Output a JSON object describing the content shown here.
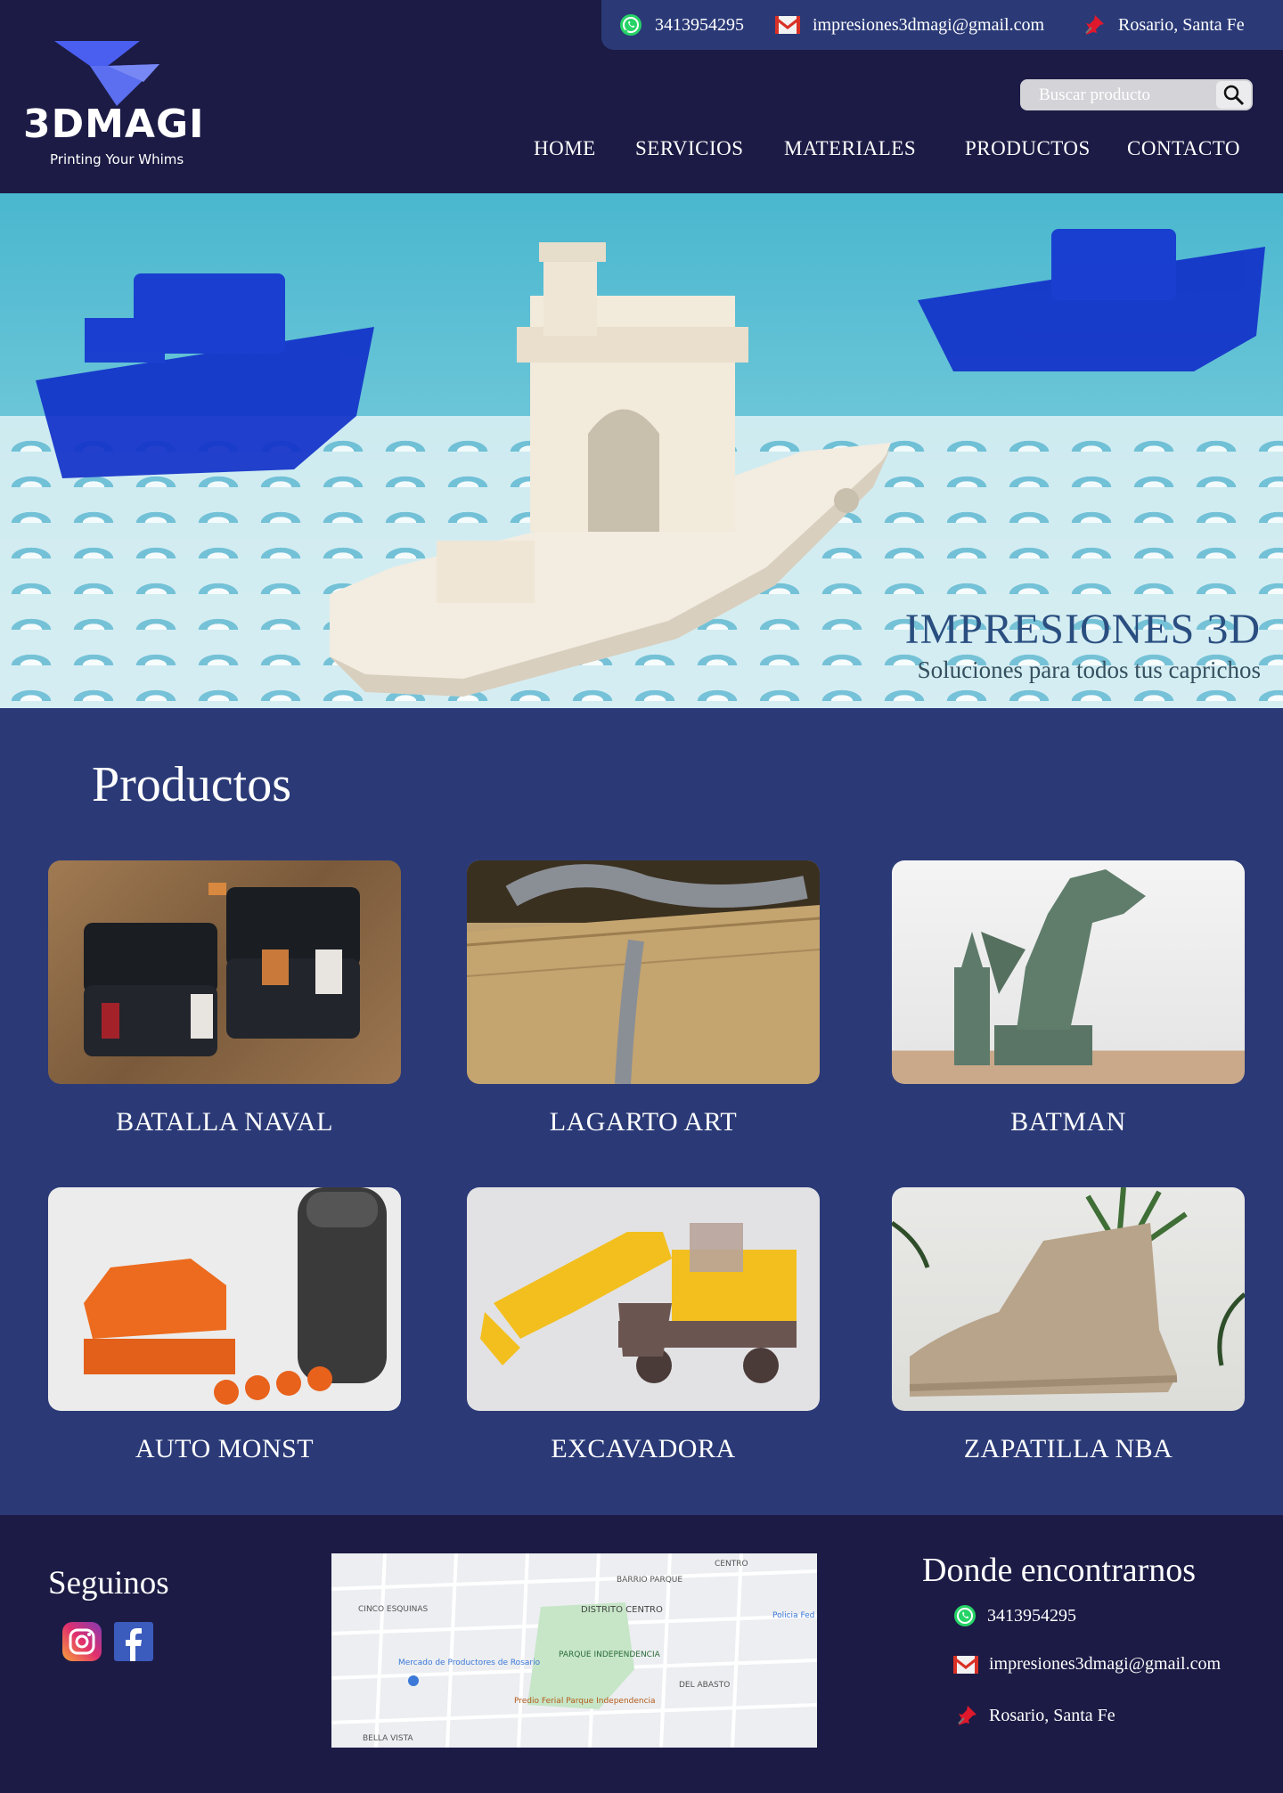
{
  "contact": {
    "phone": "3413954295",
    "email": "impresiones3dmagi@gmail.com",
    "location": "Rosario, Santa Fe"
  },
  "brand": {
    "name": "3DMAGI",
    "tagline": "Printing Your Whims"
  },
  "search": {
    "placeholder": "Buscar producto"
  },
  "nav": {
    "items": [
      "HOME",
      "SERVICIOS",
      "MATERIALES",
      "PRODUCTOS",
      "CONTACTO"
    ]
  },
  "hero": {
    "title": "IMPRESIONES 3D",
    "subtitle": "Soluciones para todos tus caprichos"
  },
  "products": {
    "heading": "Productos",
    "items": [
      "BATALLA NAVAL",
      "LAGARTO ART",
      "BATMAN",
      "AUTO MONST",
      "EXCAVADORA",
      "ZAPATILLA NBA"
    ]
  },
  "footer": {
    "follow_heading": "Seguinos",
    "where_heading": "Donde encontrarnos",
    "phone": "3413954295",
    "email": "impresiones3dmagi@gmail.com",
    "location": "Rosario, Santa Fe",
    "map_labels": [
      "CENTRO",
      "BARRIO PARQUE",
      "CINCO ESQUINAS",
      "DISTRITO CENTRO",
      "PARQUE INDEPENDENCIA",
      "DEL ABASTO",
      "BELLA VISTA",
      "Mercado de Productores de Rosario",
      "Policia Fed",
      "Predio Ferial Parque Independencia"
    ]
  },
  "colors": {
    "header_bg": "#1c1b45",
    "section_bg": "#2b3a77",
    "accent_blue": "#5b6ff0"
  }
}
